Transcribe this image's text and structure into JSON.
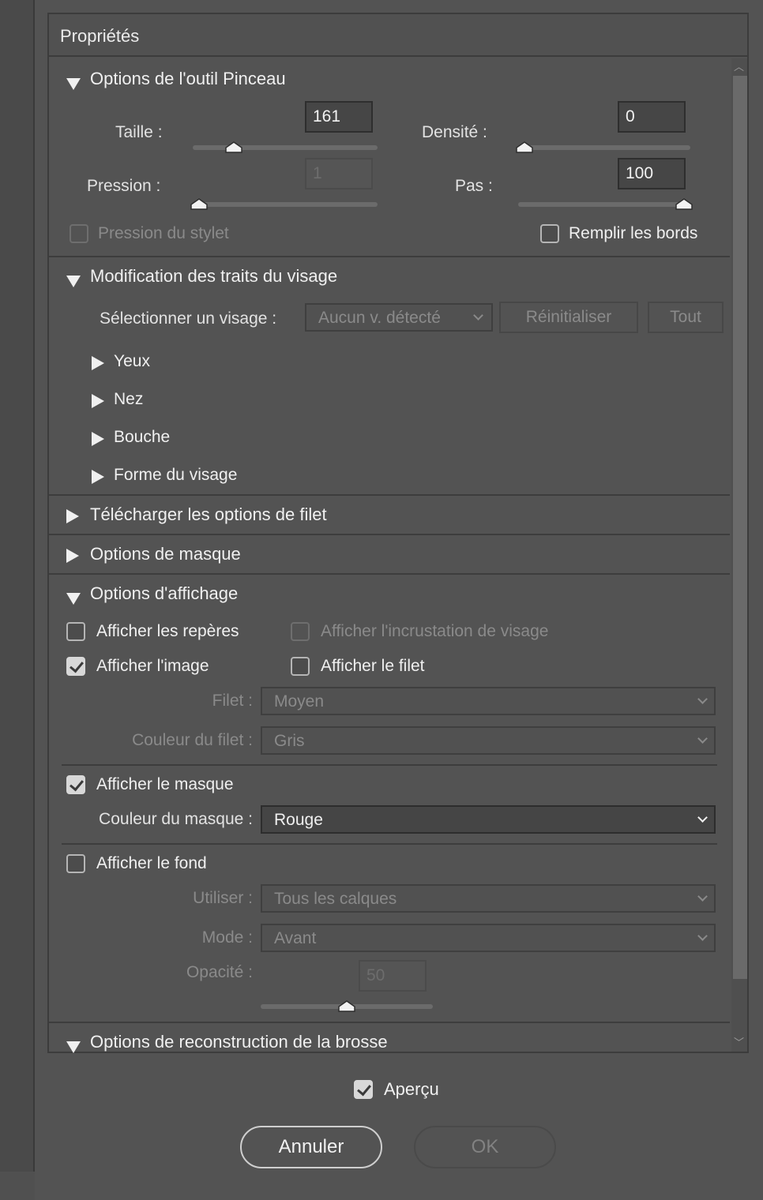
{
  "panel": {
    "title": "Propriétés"
  },
  "brush": {
    "title": "Options de l'outil Pinceau",
    "taille_label": "Taille :",
    "taille_value": "161",
    "taille_level": 0.2,
    "densite_label": "Densité :",
    "densite_value": "0",
    "densite_level": 0.0,
    "pression_label": "Pression :",
    "pression_value": "1",
    "pression_level": 0.0,
    "pas_label": "Pas :",
    "pas_value": "100",
    "pas_level": 1.0,
    "stylet_label": "Pression du stylet",
    "remplir_label": "Remplir les bords"
  },
  "face": {
    "title": "Modification des traits du visage",
    "select_label": "Sélectionner un visage :",
    "select_value": "Aucun v. détecté",
    "reset_button": "Réinitialiser",
    "all_button": "Tout",
    "items": [
      "Yeux",
      "Nez",
      "Bouche",
      "Forme du visage"
    ]
  },
  "mesh_load": {
    "title": "Télécharger les options de filet"
  },
  "mask_options": {
    "title": "Options de masque"
  },
  "display": {
    "title": "Options d'affichage",
    "show_reperes": "Afficher les repères",
    "show_incrustation": "Afficher l'incrustation de visage",
    "show_image": "Afficher l'image",
    "show_image_checked": true,
    "show_filet": "Afficher le filet",
    "filet_label": "Filet :",
    "filet_value": "Moyen",
    "filet_color_label": "Couleur du filet :",
    "filet_color_value": "Gris",
    "show_mask": "Afficher le masque",
    "show_mask_checked": true,
    "mask_color_label": "Couleur du masque :",
    "mask_color_value": "Rouge",
    "show_fond": "Afficher le fond",
    "utiliser_label": "Utiliser :",
    "utiliser_value": "Tous les calques",
    "mode_label": "Mode :",
    "mode_value": "Avant",
    "opacite_label": "Opacité :",
    "opacite_value": "50",
    "opacite_level": 0.5
  },
  "reconstruction": {
    "title": "Options de reconstruction de la brosse"
  },
  "footer": {
    "apercu_label": "Aperçu",
    "apercu_checked": true,
    "cancel_label": "Annuler",
    "ok_label": "OK"
  }
}
